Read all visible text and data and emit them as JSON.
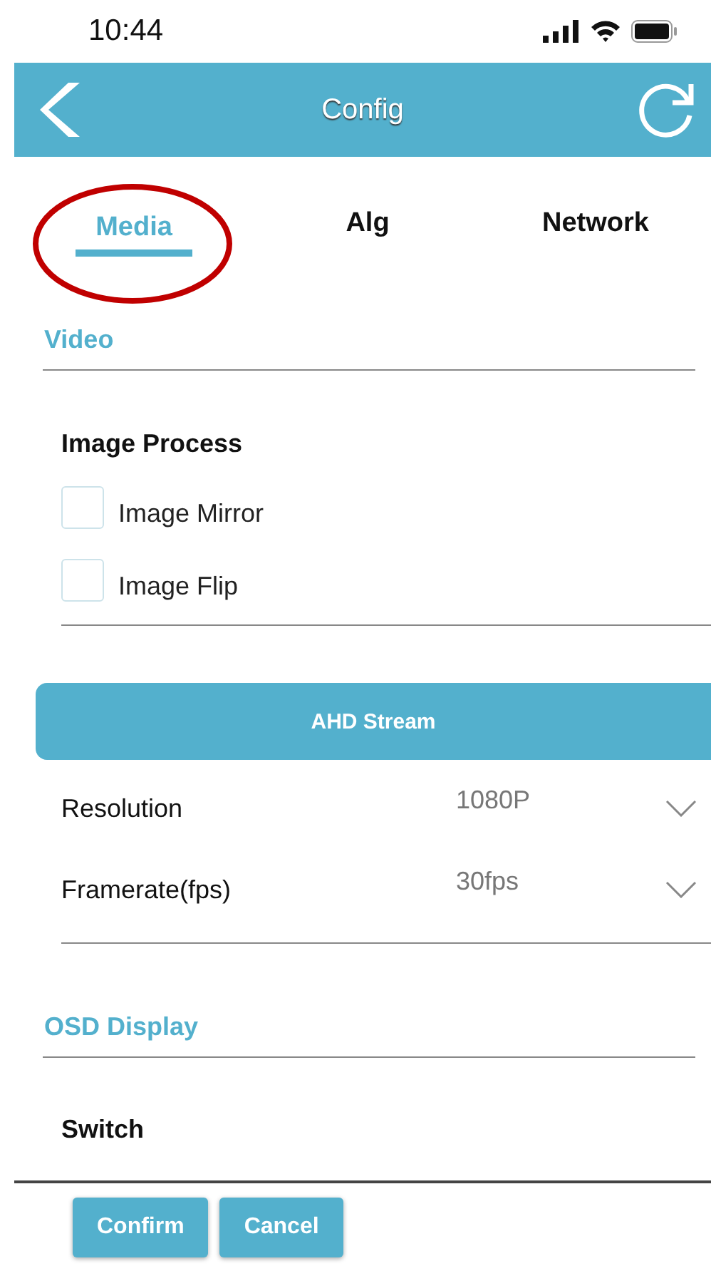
{
  "status_bar": {
    "time": "10:44"
  },
  "header": {
    "title": "Config"
  },
  "tabs": [
    {
      "label": "Media",
      "selected": true,
      "circled": true
    },
    {
      "label": "Alg",
      "selected": false,
      "circled": false
    },
    {
      "label": "Network",
      "selected": false,
      "circled": false
    }
  ],
  "video": {
    "title": "Video",
    "group_title": "Image Process",
    "options": [
      {
        "label": "Image Mirror",
        "checked": false
      },
      {
        "label": "Image Flip",
        "checked": false
      }
    ]
  },
  "stream": {
    "title": "AHD Stream",
    "settings": [
      {
        "label": "Resolution",
        "value": "1080P"
      },
      {
        "label": "Framerate(fps)",
        "value": "30fps"
      }
    ]
  },
  "osd": {
    "title": "OSD Display",
    "group_title": "Switch"
  },
  "buttons": [
    "Confirm",
    "Cancel"
  ]
}
